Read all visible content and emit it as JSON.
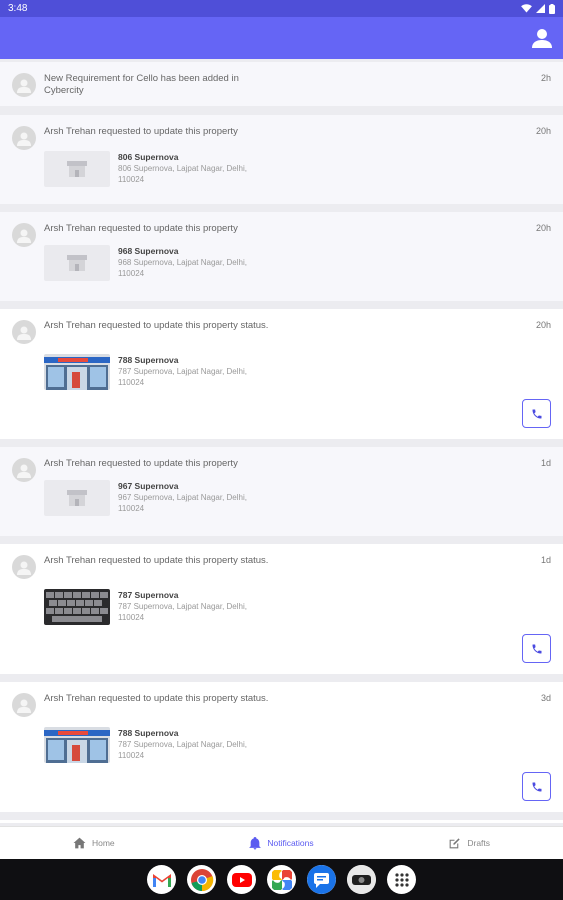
{
  "status_bar": {
    "time": "3:48"
  },
  "notifications": [
    {
      "message": "New Requirement for Cello has been added in Cybercity",
      "time": "2h"
    },
    {
      "message": "Arsh Trehan requested to update this property",
      "time": "20h",
      "property": {
        "name": "806 Supernova",
        "address": "806 Supernova, Lajpat Nagar, Delhi, 110024"
      }
    },
    {
      "message": "Arsh Trehan requested to update this property",
      "time": "20h",
      "property": {
        "name": "968 Supernova",
        "address": "968 Supernova, Lajpat Nagar, Delhi, 110024"
      }
    },
    {
      "message": "Arsh Trehan requested to update this property status.",
      "time": "20h",
      "property": {
        "name": "788 Supernova",
        "address": "787 Supernova, Lajpat Nagar, Delhi, 110024"
      }
    },
    {
      "message": "Arsh Trehan requested to update this property",
      "time": "1d",
      "property": {
        "name": "967 Supernova",
        "address": "967 Supernova, Lajpat Nagar, Delhi, 110024"
      }
    },
    {
      "message": "Arsh Trehan requested to update this property status.",
      "time": "1d",
      "property": {
        "name": "787 Supernova",
        "address": "787 Supernova, Lajpat Nagar, Delhi, 110024"
      }
    },
    {
      "message": "Arsh Trehan requested to update this property status.",
      "time": "3d",
      "property": {
        "name": "788 Supernova",
        "address": "787 Supernova, Lajpat Nagar, Delhi, 110024"
      }
    }
  ],
  "bottom_nav": [
    {
      "label": "Home",
      "icon": "home-icon"
    },
    {
      "label": "Notifications",
      "icon": "bell-icon"
    },
    {
      "label": "Drafts",
      "icon": "edit-icon"
    }
  ],
  "colors": {
    "accent": "#6565f5",
    "status_bar": "#4f4fd8",
    "active_tab": "#5b5bf0"
  },
  "dock_apps": [
    "gmail-icon",
    "chrome-icon",
    "youtube-icon",
    "photos-icon",
    "messages-icon",
    "camera-icon",
    "apps-icon"
  ]
}
